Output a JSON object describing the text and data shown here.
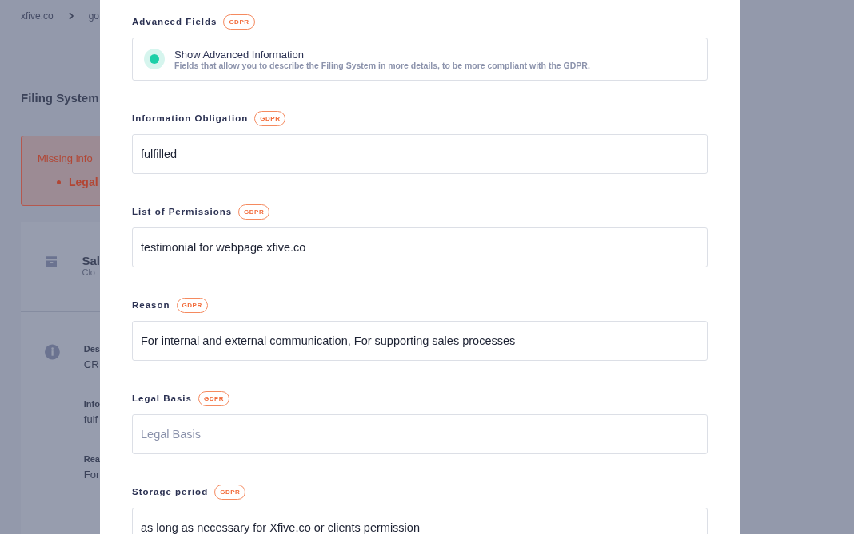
{
  "background_page": {
    "breadcrumbs": [
      "xfive.co",
      "go"
    ],
    "title": "Filing System",
    "alert": {
      "message": "Missing info",
      "items": [
        "Legal"
      ]
    },
    "card": {
      "name": "Sal",
      "subtitle": "Clo",
      "details": [
        {
          "label": "Des",
          "value": "CR"
        },
        {
          "label": "Info",
          "value": "fulf"
        },
        {
          "label": "Rea",
          "value": "For"
        }
      ]
    }
  },
  "modal": {
    "fields": [
      {
        "kind": "toggle",
        "label": "Advanced Fields",
        "badge": "GDPR",
        "option": "Show Advanced Information",
        "description": "Fields that allow you to describe the Filing System in more details, to be more compliant with the GDPR.",
        "on": true
      },
      {
        "kind": "text",
        "label": "Information Obligation",
        "badge": "GDPR",
        "value": "fulfilled"
      },
      {
        "kind": "text",
        "label": "List of Permissions",
        "badge": "GDPR",
        "value": "testimonial for webpage xfive.co"
      },
      {
        "kind": "text",
        "label": "Reason",
        "badge": "GDPR",
        "value": "For internal and external communication, For supporting sales processes"
      },
      {
        "kind": "text",
        "label": "Legal Basis",
        "badge": "GDPR",
        "placeholder": "Legal Basis"
      },
      {
        "kind": "text",
        "label": "Storage period",
        "badge": "GDPR",
        "value": "as long as necessary for Xfive.co or clients permission"
      }
    ]
  }
}
